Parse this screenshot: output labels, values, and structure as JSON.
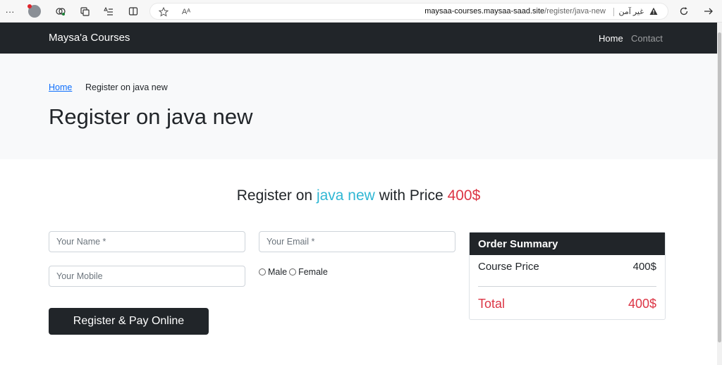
{
  "browser": {
    "url_host": "maysaa-courses.maysaa-saad.site",
    "url_path": "/register/java-new",
    "security_text": "غير آمن",
    "menu_glyph": "···",
    "read_aloud_glyph": "Aᴬ"
  },
  "nav": {
    "brand": "Maysa'a Courses",
    "links": [
      "Home",
      "Contact"
    ]
  },
  "breadcrumb": {
    "home": "Home",
    "current": "Register on java new"
  },
  "page": {
    "title": "Register on java new"
  },
  "register": {
    "heading_prefix": "Register on",
    "course": "java new",
    "heading_mid": "with Price",
    "price": "400$"
  },
  "form": {
    "name_placeholder": "Your Name *",
    "email_placeholder": "Your Email *",
    "mobile_placeholder": "Your Mobile",
    "gender_options": [
      "Male",
      "Female"
    ],
    "submit": "Register & Pay Online"
  },
  "summary": {
    "title": "Order Summary",
    "course_price_label": "Course Price",
    "course_price_value": "400$",
    "total_label": "Total",
    "total_value": "400$"
  },
  "colors": {
    "dark": "#212529",
    "accent_course": "#30b7d4",
    "accent_price": "#dc3545",
    "link": "#0d6efd"
  }
}
